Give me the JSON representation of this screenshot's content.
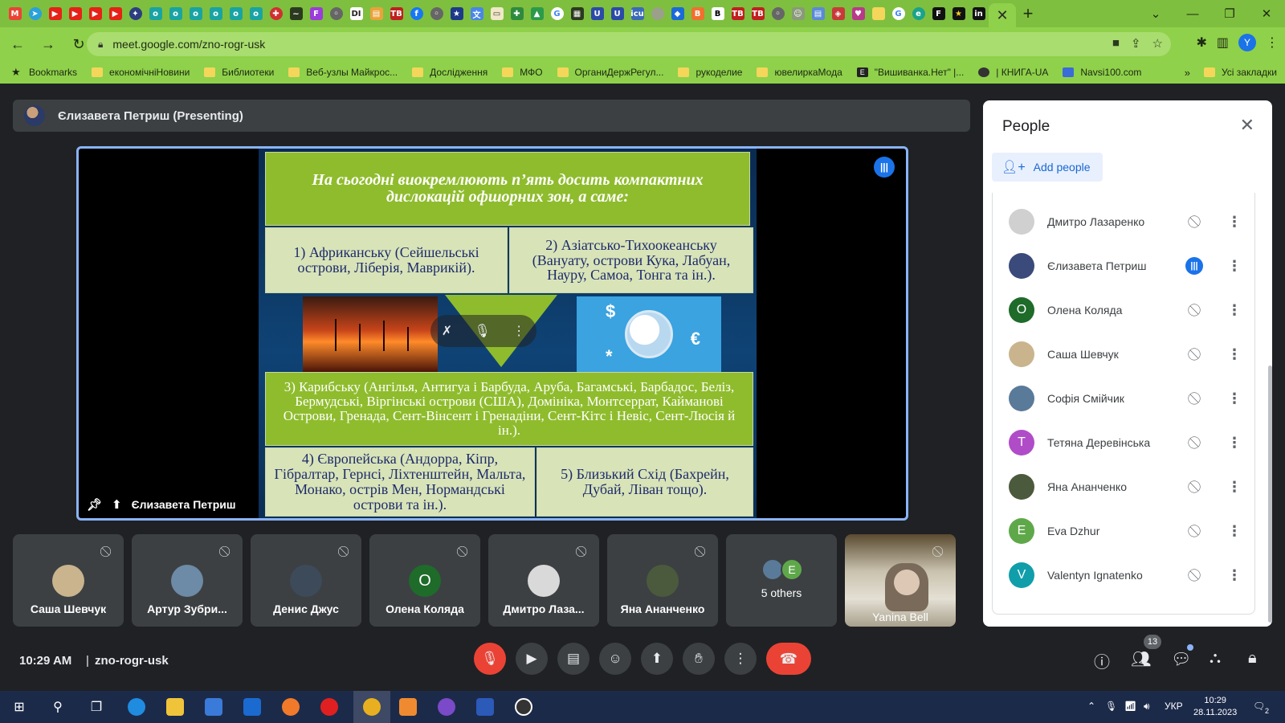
{
  "browser": {
    "url": "meet.google.com/zno-rogr-usk",
    "profile_initial": "Y",
    "new_tab_label": "+",
    "tab_close": "✕",
    "bookmarks": [
      {
        "label": "Bookmarks",
        "icon": "star-icon"
      },
      {
        "label": "економічніНовини",
        "icon": "folder-icon"
      },
      {
        "label": "Библиотеки",
        "icon": "folder-icon"
      },
      {
        "label": "Веб-узлы Майкрос...",
        "icon": "folder-icon"
      },
      {
        "label": "Дослідження",
        "icon": "folder-icon"
      },
      {
        "label": "МФО",
        "icon": "folder-icon"
      },
      {
        "label": "ОрганиДержРегул...",
        "icon": "folder-icon"
      },
      {
        "label": "рукоделие",
        "icon": "folder-icon"
      },
      {
        "label": "ювелиркаМода",
        "icon": "folder-icon"
      },
      {
        "label": "\"Вишиванка.Нет\" |...",
        "icon": "site-icon"
      },
      {
        "label": "| КНИГА-UA",
        "icon": "globe-icon"
      },
      {
        "label": "Navsi100.com",
        "icon": "site-icon"
      }
    ],
    "bookmarks_more": "»",
    "all_bookmarks": "Усі закладки"
  },
  "meet": {
    "presenter_bar": "Єлизавета Петриш (Presenting)",
    "stage_label": "Єлизавета Петриш",
    "slide": {
      "title": "На сьогодні виокремлюють п’ять досить компактних дислокацій офшорних зон, а саме:",
      "africa": "1) Африканську (Сейшельські острови, Ліберія, Маврикій).",
      "asia": "2) Азіатсько-Тихоокеанську (Вануату, острови Кука, Лабуан, Науру, Самоа, Тонга та ін.).",
      "caribbean": "3) Карибську (Ангілья, Антигуа і Барбуда, Аруба, Багамські, Барбадос, Беліз, Бермудські, Віргінські острови (США), Домініка, Монтсеррат, Кайманові Острови, Гренада, Сент-Вінсент і Гренадіни, Сент-Кітс і Невіс, Сент-Люсія й ін.).",
      "europe": "4) Європейська (Андорра, Кіпр, Гібралтар, Гернсі, Ліхтенштейн, Мальта, Монако, острів Мен, Нормандські острови та ін.).",
      "mideast": "5) Близький Схід (Бахрейн, Дубай, Ліван тощо)."
    },
    "tiles": [
      {
        "name": "Саша Шевчук",
        "avatar": "photo",
        "color": "#c9b48e"
      },
      {
        "name": "Артур Зубри...",
        "avatar": "photo",
        "color": "#6d8aa6"
      },
      {
        "name": "Денис Джус",
        "avatar": "photo",
        "color": "#3d4a5a"
      },
      {
        "name": "Олена Коляда",
        "avatar": "О",
        "color": "#1e6b2a"
      },
      {
        "name": "Дмитро Лаза...",
        "avatar": "photo",
        "color": "#d9d9d9"
      },
      {
        "name": "Яна Ананченко",
        "avatar": "photo",
        "color": "#4b5a3c"
      }
    ],
    "others_tile": {
      "label": "5 others",
      "avatar_initial": "E",
      "avatar_color": "#5fa84a"
    },
    "video_tile": {
      "name": "Yanina Bell"
    },
    "bottom": {
      "time": "10:29 AM",
      "separator": "|",
      "meeting_code": "zno-rogr-usk",
      "people_count": "13"
    }
  },
  "people_panel": {
    "title": "People",
    "add_people": "Add people",
    "participants": [
      {
        "name": "Дмитро Лазаренко",
        "avatar": "photo",
        "color": "#d0d0d0",
        "mic": "muted"
      },
      {
        "name": "Єлизавета Петриш",
        "avatar": "photo",
        "color": "#3a4a7a",
        "mic": "speaking"
      },
      {
        "name": "Олена Коляда",
        "avatar": "О",
        "color": "#1e6b2a",
        "mic": "muted"
      },
      {
        "name": "Саша Шевчук",
        "avatar": "photo",
        "color": "#c9b48e",
        "mic": "muted"
      },
      {
        "name": "Софія Смійчик",
        "avatar": "photo",
        "color": "#5a7a9a",
        "mic": "muted"
      },
      {
        "name": "Тетяна Деревінська",
        "avatar": "Т",
        "color": "#b04cc8",
        "mic": "muted"
      },
      {
        "name": "Яна Ананченко",
        "avatar": "photo",
        "color": "#4b5a3c",
        "mic": "muted"
      },
      {
        "name": "Eva Dzhur",
        "avatar": "E",
        "color": "#5fa84a",
        "mic": "muted"
      },
      {
        "name": "Valentyn Ignatenko",
        "avatar": "V",
        "color": "#109eaa",
        "mic": "muted"
      }
    ]
  },
  "taskbar": {
    "language": "УКР",
    "clock_time": "10:29",
    "clock_date": "28.11.2023",
    "notifications": "2"
  }
}
